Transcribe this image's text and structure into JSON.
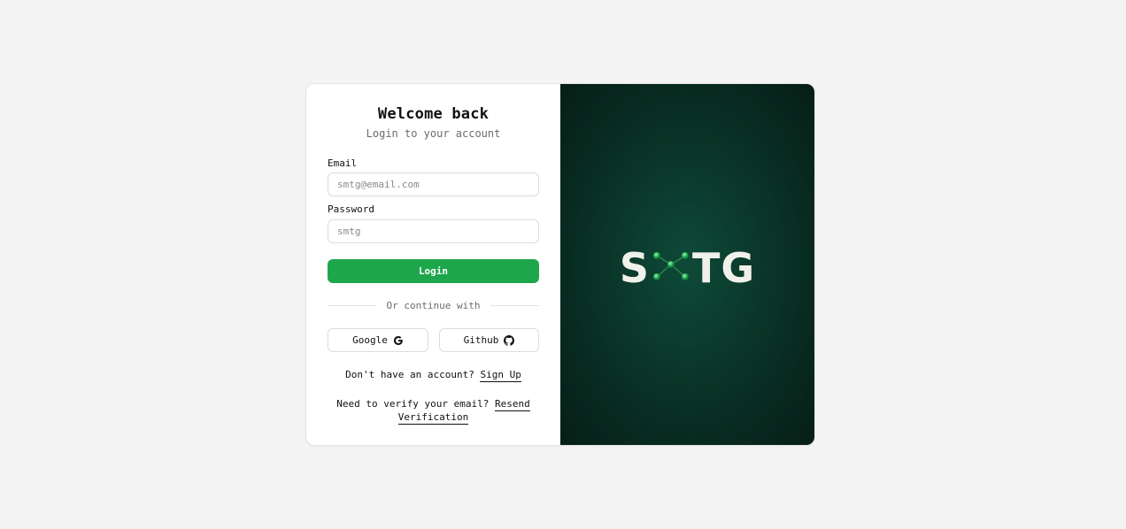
{
  "login": {
    "title": "Welcome back",
    "subtitle": "Login to your account",
    "email_label": "Email",
    "email_placeholder": "smtg@email.com",
    "password_label": "Password",
    "password_placeholder": "smtg",
    "login_button": "Login",
    "divider_text": "Or continue with",
    "google_button": "Google",
    "github_button": "Github",
    "signup_prompt": "Don't have an account?",
    "signup_link": "Sign Up",
    "verify_prompt": "Need to verify your email?",
    "verify_link": "Resend Verification"
  },
  "brand": {
    "logo_left": "S",
    "logo_right": "TG",
    "logo_icon": "molecule-icon",
    "accent_color": "#1ea64d",
    "panel_color": "#0b3a2c"
  },
  "icons": {
    "google": "google-icon",
    "github": "github-icon"
  }
}
